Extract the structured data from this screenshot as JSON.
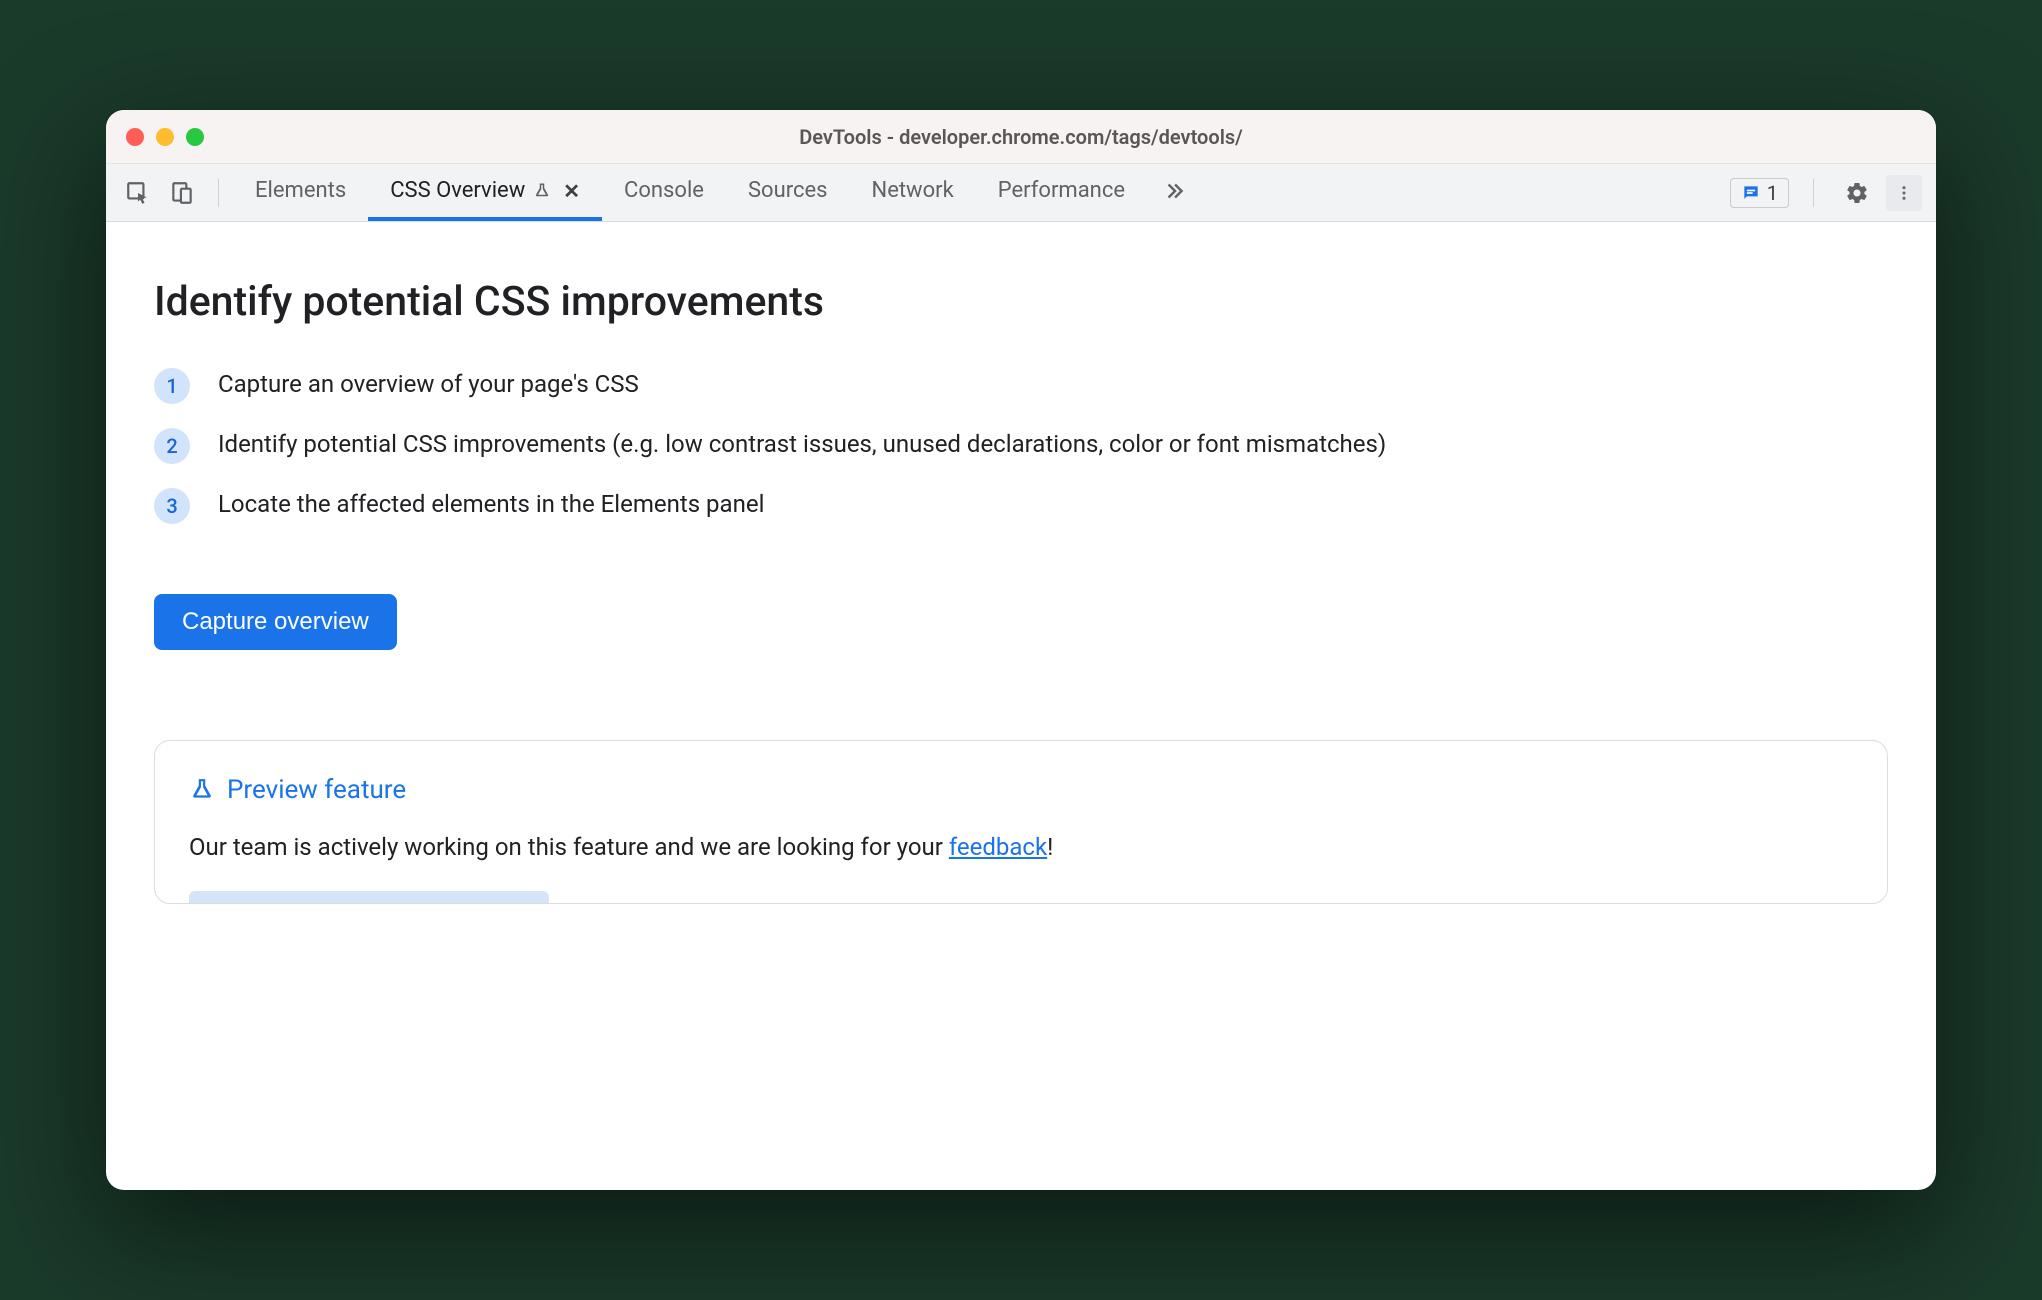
{
  "window": {
    "title": "DevTools - developer.chrome.com/tags/devtools/"
  },
  "toolbar": {
    "tabs": [
      {
        "label": "Elements",
        "active": false,
        "experimental": false,
        "closable": false
      },
      {
        "label": "CSS Overview",
        "active": true,
        "experimental": true,
        "closable": true
      },
      {
        "label": "Console",
        "active": false,
        "experimental": false,
        "closable": false
      },
      {
        "label": "Sources",
        "active": false,
        "experimental": false,
        "closable": false
      },
      {
        "label": "Network",
        "active": false,
        "experimental": false,
        "closable": false
      },
      {
        "label": "Performance",
        "active": false,
        "experimental": false,
        "closable": false
      }
    ],
    "issues_count": "1"
  },
  "main": {
    "heading": "Identify potential CSS improvements",
    "steps": [
      "Capture an overview of your page's CSS",
      "Identify potential CSS improvements (e.g. low contrast issues, unused declarations, color or font mismatches)",
      "Locate the affected elements in the Elements panel"
    ],
    "capture_button": "Capture overview"
  },
  "preview": {
    "title": "Preview feature",
    "body_prefix": "Our team is actively working on this feature and we are looking for your ",
    "link_text": "feedback",
    "body_suffix": "!"
  }
}
